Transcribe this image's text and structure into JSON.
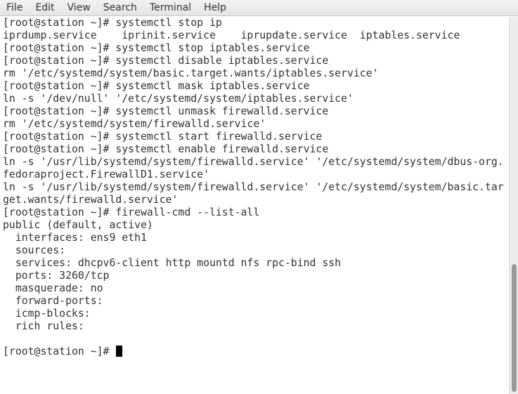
{
  "menubar": {
    "items": [
      {
        "label": "File"
      },
      {
        "label": "Edit"
      },
      {
        "label": "View"
      },
      {
        "label": "Search"
      },
      {
        "label": "Terminal"
      },
      {
        "label": "Help"
      }
    ]
  },
  "terminal": {
    "lines": [
      "[root@station ~]# systemctl stop ip",
      "iprdump.service    iprinit.service    iprupdate.service  iptables.service",
      "[root@station ~]# systemctl stop iptables.service",
      "[root@station ~]# systemctl disable iptables.service",
      "rm '/etc/systemd/system/basic.target.wants/iptables.service'",
      "[root@station ~]# systemctl mask iptables.service",
      "ln -s '/dev/null' '/etc/systemd/system/iptables.service'",
      "[root@station ~]# systemctl unmask firewalld.service",
      "rm '/etc/systemd/system/firewalld.service'",
      "[root@station ~]# systemctl start firewalld.service",
      "[root@station ~]# systemctl enable firewalld.service",
      "ln -s '/usr/lib/systemd/system/firewalld.service' '/etc/systemd/system/dbus-org.",
      "fedoraproject.FirewallD1.service'",
      "ln -s '/usr/lib/systemd/system/firewalld.service' '/etc/systemd/system/basic.tar",
      "get.wants/firewalld.service'",
      "[root@station ~]# firewall-cmd --list-all",
      "public (default, active)",
      "  interfaces: ens9 eth1",
      "  sources:",
      "  services: dhcpv6-client http mountd nfs rpc-bind ssh",
      "  ports: 3260/tcp",
      "  masquerade: no",
      "  forward-ports:",
      "  icmp-blocks:",
      "  rich rules:",
      ""
    ],
    "prompt": "[root@station ~]# "
  }
}
